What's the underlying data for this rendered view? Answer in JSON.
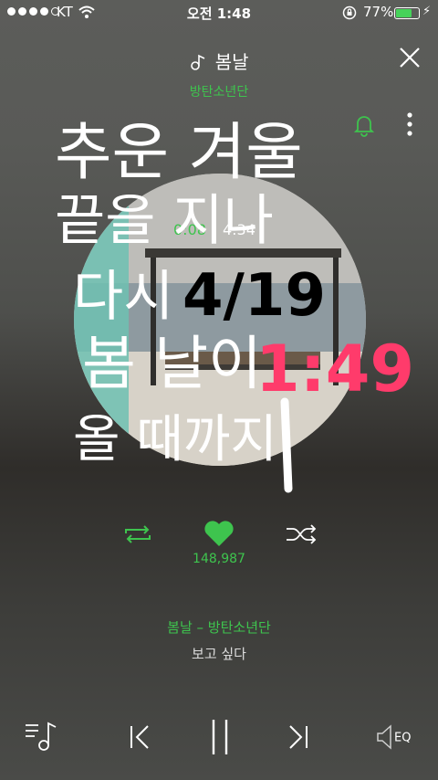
{
  "status_bar": {
    "carrier": "KT",
    "time": "오전 1:48",
    "battery_percent": "77%",
    "battery_level": 0.77
  },
  "header": {
    "song_title": "봄날",
    "artist": "방탄소년단"
  },
  "player": {
    "elapsed": "0:08",
    "duration": "4:34",
    "like_count": "148,987",
    "now_playing": "봄날 – 방탄소년단",
    "lyric_line": "보고 싶다",
    "eq_label": "EQ"
  },
  "handwriting": {
    "line1": "추운 겨울",
    "line2": "끝을 지나",
    "line3": "다시",
    "line4": "봄 날이",
    "line5": "올 때까지",
    "date": "4/19",
    "time": "1:49"
  },
  "colors": {
    "accent": "#3ec44e",
    "handwriting_time": "#ff3b6b"
  }
}
